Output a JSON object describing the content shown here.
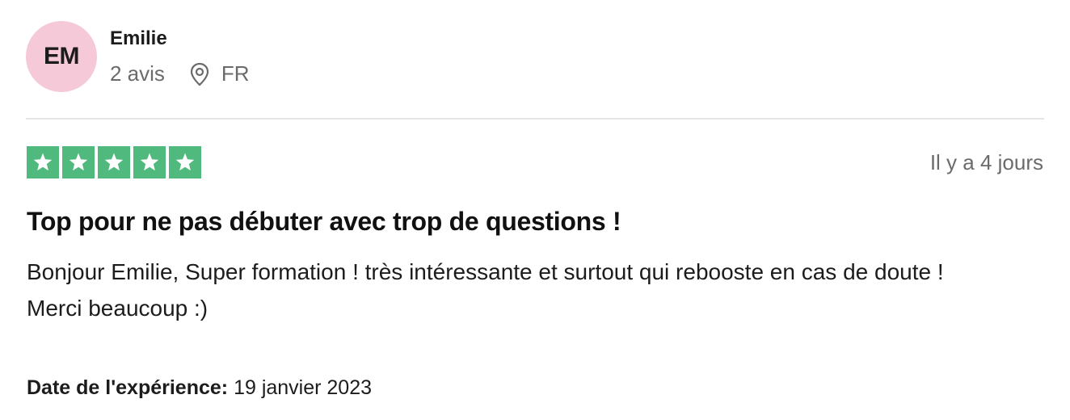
{
  "reviewer": {
    "initials": "EM",
    "name": "Emilie",
    "review_count": "2 avis",
    "country": "FR",
    "avatar_color": "#f6c9d9"
  },
  "rating": {
    "stars": 5,
    "max": 5,
    "star_color": "#4fb97e",
    "icon": "star-icon"
  },
  "review": {
    "date_ago": "Il y a 4 jours",
    "title": "Top pour ne pas débuter avec trop de questions !",
    "body_line1": "Bonjour Emilie, Super formation ! très intéressante et surtout qui rebooste en cas de doute !",
    "body_line2": "Merci beaucoup :)",
    "experience_label": "Date de l'expérience:",
    "experience_date": "19 janvier 2023"
  },
  "icons": {
    "location": "location-pin-icon"
  }
}
